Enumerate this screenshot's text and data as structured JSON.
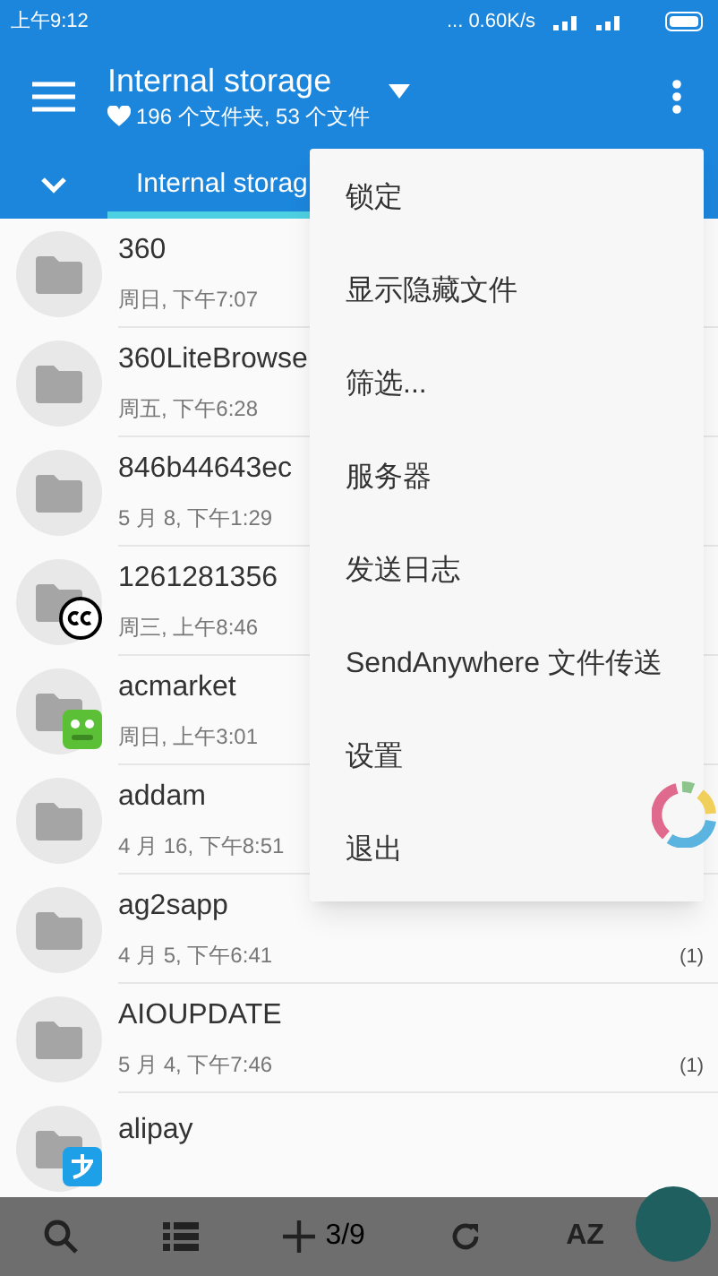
{
  "status_bar": {
    "time": "上午9:12",
    "speed": "... 0.60K/s"
  },
  "app_bar": {
    "title": "Internal storage",
    "subtitle": "196 个文件夹, 53 个文件"
  },
  "tabs": [
    {
      "label": "Internal storag",
      "selected": true
    }
  ],
  "files": [
    {
      "kind": "plain",
      "name": "360",
      "date": "周日, 下午7:07"
    },
    {
      "kind": "plain",
      "name": "360LiteBrowse",
      "date": "周五, 下午6:28"
    },
    {
      "kind": "plain",
      "name": "846b44643ec",
      "date": "5 月 8, 下午1:29"
    },
    {
      "kind": "cc",
      "name": "1261281356",
      "date": "周三, 上午8:46"
    },
    {
      "kind": "green",
      "name": "acmarket",
      "date": "周日, 上午3:01"
    },
    {
      "kind": "plain",
      "name": "addam",
      "date": "4 月 16, 下午8:51"
    },
    {
      "kind": "plain",
      "name": "ag2sapp",
      "date": "4 月 5, 下午6:41",
      "count": "(1)"
    },
    {
      "kind": "plain",
      "name": "AIOUPDATE",
      "date": "5 月 4, 下午7:46",
      "count": "(1)"
    },
    {
      "kind": "blue",
      "name": "alipay"
    }
  ],
  "menu": [
    "锁定",
    "显示隐藏文件",
    "筛选...",
    "服务器",
    "发送日志",
    "SendAnywhere 文件传送",
    "设置",
    "退出"
  ],
  "bottom_bar": {
    "page": "3/9",
    "sort": "AZ"
  }
}
